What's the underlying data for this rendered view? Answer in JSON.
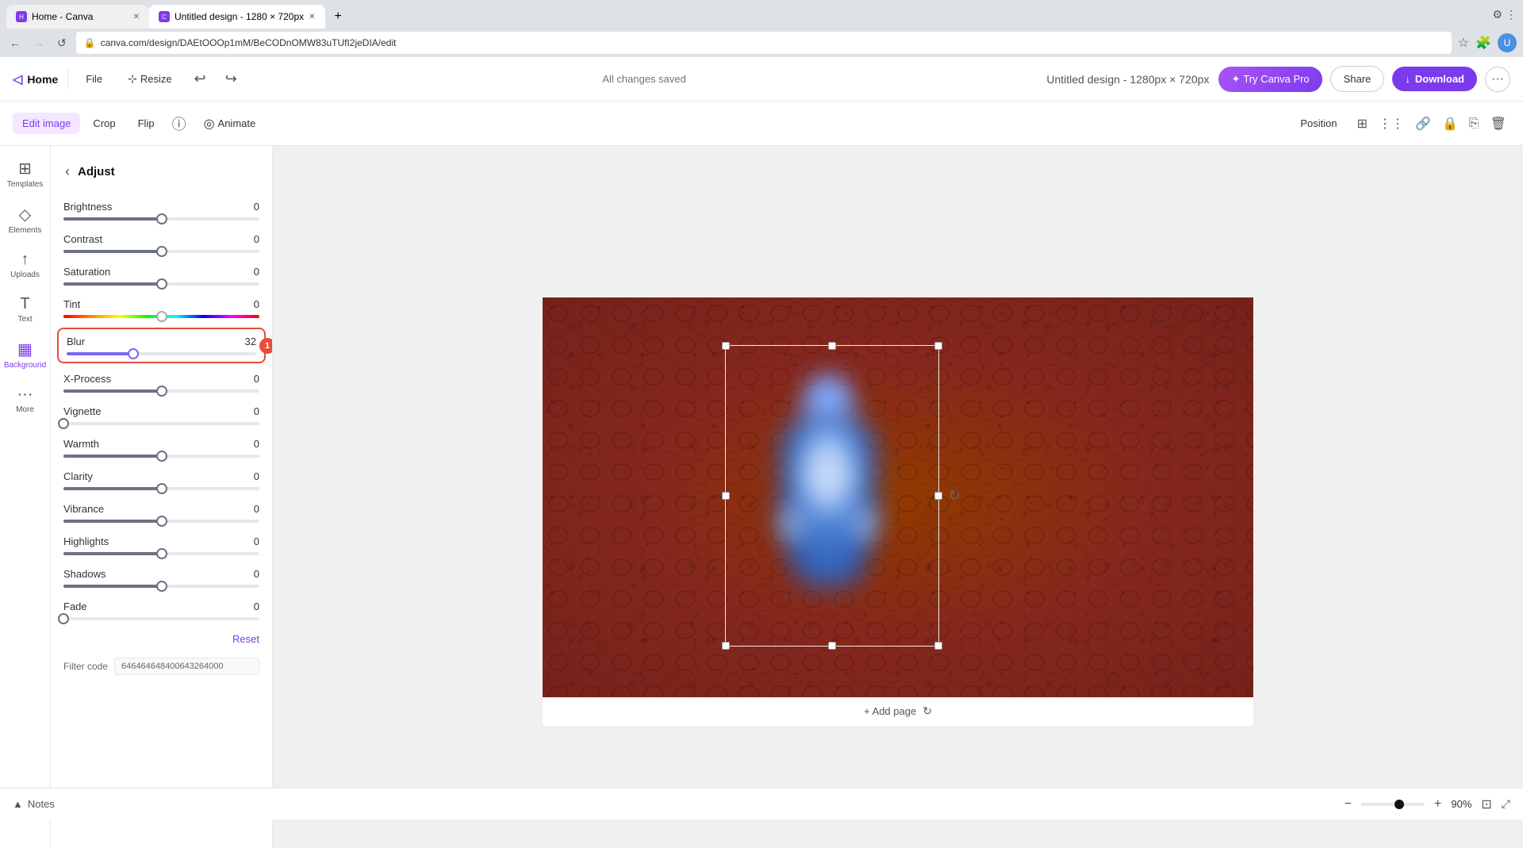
{
  "browser": {
    "tabs": [
      {
        "label": "Home - Canva",
        "active": false,
        "favicon": "H"
      },
      {
        "label": "Untitled design - 1280 × 720px",
        "active": true,
        "favicon": "C"
      }
    ],
    "url": "canva.com/design/DAEtOOOp1mM/BeCODnOMW83uTUfI2jeDIA/edit",
    "nav_buttons": [
      "←",
      "→",
      "↺"
    ]
  },
  "header": {
    "home_label": "Home",
    "file_label": "File",
    "resize_label": "Resize",
    "saved_status": "All changes saved",
    "design_title": "Untitled design - 1280px × 720px",
    "try_pro_label": "Try Canva Pro",
    "share_label": "Share",
    "download_label": "Download",
    "more_label": "..."
  },
  "toolbar": {
    "edit_image_label": "Edit image",
    "crop_label": "Crop",
    "flip_label": "Flip",
    "info_label": "ℹ",
    "animate_label": "Animate",
    "position_label": "Position"
  },
  "sidebar": {
    "icons": [
      {
        "id": "templates",
        "label": "Templates",
        "symbol": "⊞"
      },
      {
        "id": "elements",
        "label": "Elements",
        "symbol": "◇"
      },
      {
        "id": "uploads",
        "label": "Uploads",
        "symbol": "↑"
      },
      {
        "id": "text",
        "label": "Text",
        "symbol": "T"
      },
      {
        "id": "background",
        "label": "Background",
        "symbol": "▦"
      },
      {
        "id": "more",
        "label": "More",
        "symbol": "···"
      }
    ]
  },
  "adjust_panel": {
    "title": "Adjust",
    "back_icon": "‹",
    "sliders": [
      {
        "id": "brightness",
        "label": "Brightness",
        "value": 0,
        "percent": 50
      },
      {
        "id": "contrast",
        "label": "Contrast",
        "value": 0,
        "percent": 50
      },
      {
        "id": "saturation",
        "label": "Saturation",
        "value": 0,
        "percent": 50
      },
      {
        "id": "tint",
        "label": "Tint",
        "value": 0,
        "percent": 50,
        "rainbow": true
      },
      {
        "id": "blur",
        "label": "Blur",
        "value": 32,
        "percent": 35,
        "highlighted": true
      },
      {
        "id": "x_process",
        "label": "X-Process",
        "value": 0,
        "percent": 50
      },
      {
        "id": "vignette",
        "label": "Vignette",
        "value": 0,
        "percent": 0
      },
      {
        "id": "warmth",
        "label": "Warmth",
        "value": 0,
        "percent": 50
      },
      {
        "id": "clarity",
        "label": "Clarity",
        "value": 0,
        "percent": 50
      },
      {
        "id": "vibrance",
        "label": "Vibrance",
        "value": 0,
        "percent": 50
      },
      {
        "id": "highlights",
        "label": "Highlights",
        "value": 0,
        "percent": 50
      },
      {
        "id": "shadows",
        "label": "Shadows",
        "value": 0,
        "percent": 50
      },
      {
        "id": "fade",
        "label": "Fade",
        "value": 0,
        "percent": 0
      }
    ],
    "reset_label": "Reset",
    "filter_code_label": "Filter code",
    "filter_code_value": "646464648400643264000"
  },
  "canvas": {
    "add_page_label": "+ Add page"
  },
  "bottom_bar": {
    "notes_label": "Notes",
    "zoom_percent": "90%"
  }
}
